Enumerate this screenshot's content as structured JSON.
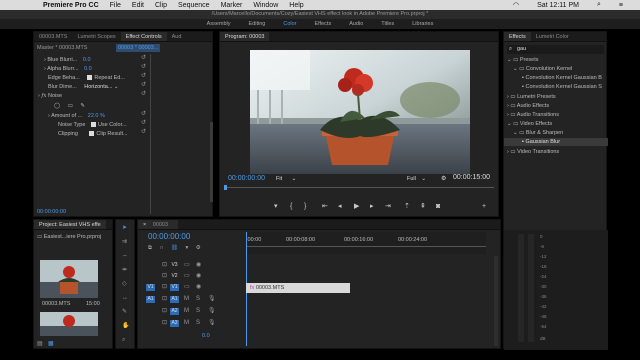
{
  "menubar": {
    "app": "Premiere Pro CC",
    "items": [
      "File",
      "Edit",
      "Clip",
      "Sequence",
      "Marker",
      "Window",
      "Help"
    ],
    "clock": "Sat 12:11 PM"
  },
  "title_path": "/Users/Marcello/Documents/Cozy/Easiest VHS effect look in Adobe Premiere Pro.prproj *",
  "workspaces": [
    "Assembly",
    "Editing",
    "Color",
    "Effects",
    "Audio",
    "Titles",
    "Libraries"
  ],
  "workspace_active": "Color",
  "source_panel": {
    "tabs": [
      "00003.MTS",
      "Lumetri Scopes",
      "Effect Controls",
      "Aud"
    ],
    "active_tab": "Effect Controls",
    "clip_header": "Master * 00003.MTS",
    "clip_selected": "00003 * 00003...",
    "props": [
      {
        "label": "Blue Blurri...",
        "value": "0.0"
      },
      {
        "label": "Alpha Blurr...",
        "value": "0.0"
      },
      {
        "label": "Edge Beha...",
        "check": "Repeat Ed..."
      },
      {
        "label": "Blur Dime...",
        "value": "Horizonta..."
      }
    ],
    "noise_title": "Noise",
    "noise_props": [
      {
        "label": "Amount of ...",
        "value": "22.0 %"
      },
      {
        "label": "Noise Type",
        "check": "Use Color..."
      },
      {
        "label": "Clipping",
        "check": "Clip Result..."
      }
    ],
    "timecode": "00:00:00:00"
  },
  "program": {
    "title": "Program: 00003",
    "timecode": "00:00:00:00",
    "fit": "Fit",
    "quality": "Full",
    "duration": "00:00:15:00"
  },
  "effects": {
    "tabs": [
      "Effects",
      "Lumetri Color"
    ],
    "search": "gau",
    "tree": [
      {
        "label": "Presets",
        "level": 0
      },
      {
        "label": "Convolution Kernel",
        "level": 1
      },
      {
        "label": "Convolution Kernel Gaussian B",
        "level": 2
      },
      {
        "label": "Convolution Kernel Gaussian S",
        "level": 2
      },
      {
        "label": "Lumetri Presets",
        "level": 0
      },
      {
        "label": "Audio Effects",
        "level": 0
      },
      {
        "label": "Audio Transitions",
        "level": 0
      },
      {
        "label": "Video Effects",
        "level": 0
      },
      {
        "label": "Blur & Sharpen",
        "level": 1
      },
      {
        "label": "Gaussian Blur",
        "level": 2,
        "selected": true
      },
      {
        "label": "Video Transitions",
        "level": 0
      }
    ]
  },
  "project": {
    "title": "Project: Easiest VHS effe",
    "bin": "Easiest...iere Pro.prproj",
    "thumb_name": "00003.MTS",
    "thumb_duration": "15:00"
  },
  "timeline": {
    "tab": "00003",
    "timecode": "00:00:00:00",
    "ruler": [
      ":00:00",
      "00:00:08:00",
      "00:00:16:00",
      "00:00:24:00"
    ],
    "video_tracks": [
      "V3",
      "V2",
      "V1"
    ],
    "audio_tracks": [
      "A1",
      "A2",
      "A3"
    ],
    "src_v": "V1",
    "src_a": "A1",
    "clip": "00003.MTS",
    "master_db": "0.0"
  },
  "meter": {
    "labels": [
      "0",
      "-6",
      "-12",
      "-18",
      "-24",
      "-30",
      "-36",
      "-42",
      "-48",
      "-54",
      "dB"
    ]
  }
}
